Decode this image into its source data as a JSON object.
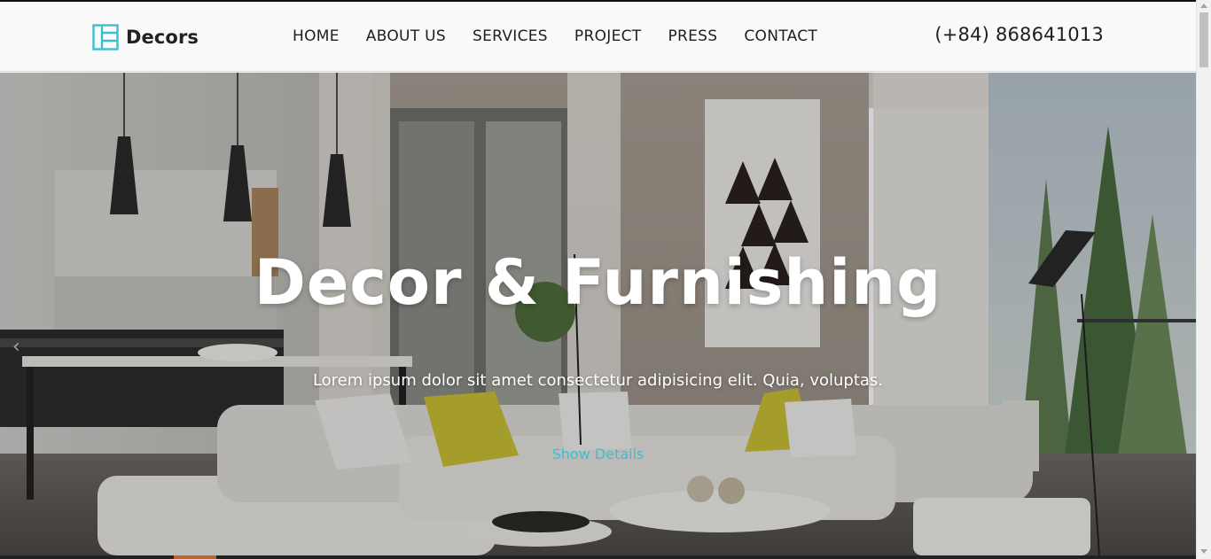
{
  "brand": {
    "name": "Decors",
    "accent": "#3cbfd1"
  },
  "nav": {
    "items": [
      "HOME",
      "ABOUT US",
      "SERVICES",
      "PROJECT",
      "PRESS",
      "CONTACT"
    ]
  },
  "header": {
    "phone": "(+84) 868641013"
  },
  "hero": {
    "title": "Decor & Furnishing",
    "subtitle": "Lorem ipsum dolor sit amet consectetur adipisicing elit. Quia, voluptas.",
    "cta": "Show Details",
    "prev_icon": "chevron-left-icon"
  }
}
